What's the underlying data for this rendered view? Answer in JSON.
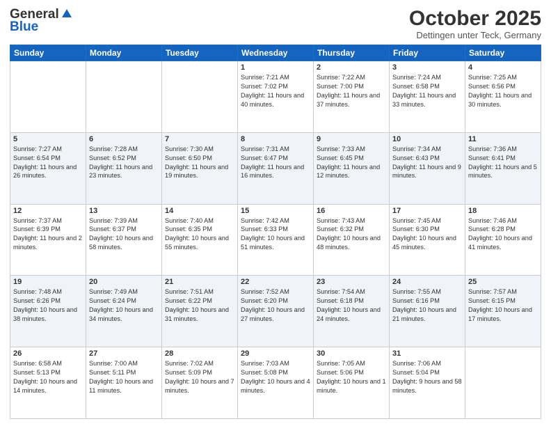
{
  "header": {
    "logo_line1": "General",
    "logo_line2": "Blue",
    "month": "October 2025",
    "location": "Dettingen unter Teck, Germany"
  },
  "weekdays": [
    "Sunday",
    "Monday",
    "Tuesday",
    "Wednesday",
    "Thursday",
    "Friday",
    "Saturday"
  ],
  "weeks": [
    [
      {
        "day": "",
        "info": ""
      },
      {
        "day": "",
        "info": ""
      },
      {
        "day": "",
        "info": ""
      },
      {
        "day": "1",
        "info": "Sunrise: 7:21 AM\nSunset: 7:02 PM\nDaylight: 11 hours and 40 minutes."
      },
      {
        "day": "2",
        "info": "Sunrise: 7:22 AM\nSunset: 7:00 PM\nDaylight: 11 hours and 37 minutes."
      },
      {
        "day": "3",
        "info": "Sunrise: 7:24 AM\nSunset: 6:58 PM\nDaylight: 11 hours and 33 minutes."
      },
      {
        "day": "4",
        "info": "Sunrise: 7:25 AM\nSunset: 6:56 PM\nDaylight: 11 hours and 30 minutes."
      }
    ],
    [
      {
        "day": "5",
        "info": "Sunrise: 7:27 AM\nSunset: 6:54 PM\nDaylight: 11 hours and 26 minutes."
      },
      {
        "day": "6",
        "info": "Sunrise: 7:28 AM\nSunset: 6:52 PM\nDaylight: 11 hours and 23 minutes."
      },
      {
        "day": "7",
        "info": "Sunrise: 7:30 AM\nSunset: 6:50 PM\nDaylight: 11 hours and 19 minutes."
      },
      {
        "day": "8",
        "info": "Sunrise: 7:31 AM\nSunset: 6:47 PM\nDaylight: 11 hours and 16 minutes."
      },
      {
        "day": "9",
        "info": "Sunrise: 7:33 AM\nSunset: 6:45 PM\nDaylight: 11 hours and 12 minutes."
      },
      {
        "day": "10",
        "info": "Sunrise: 7:34 AM\nSunset: 6:43 PM\nDaylight: 11 hours and 9 minutes."
      },
      {
        "day": "11",
        "info": "Sunrise: 7:36 AM\nSunset: 6:41 PM\nDaylight: 11 hours and 5 minutes."
      }
    ],
    [
      {
        "day": "12",
        "info": "Sunrise: 7:37 AM\nSunset: 6:39 PM\nDaylight: 11 hours and 2 minutes."
      },
      {
        "day": "13",
        "info": "Sunrise: 7:39 AM\nSunset: 6:37 PM\nDaylight: 10 hours and 58 minutes."
      },
      {
        "day": "14",
        "info": "Sunrise: 7:40 AM\nSunset: 6:35 PM\nDaylight: 10 hours and 55 minutes."
      },
      {
        "day": "15",
        "info": "Sunrise: 7:42 AM\nSunset: 6:33 PM\nDaylight: 10 hours and 51 minutes."
      },
      {
        "day": "16",
        "info": "Sunrise: 7:43 AM\nSunset: 6:32 PM\nDaylight: 10 hours and 48 minutes."
      },
      {
        "day": "17",
        "info": "Sunrise: 7:45 AM\nSunset: 6:30 PM\nDaylight: 10 hours and 45 minutes."
      },
      {
        "day": "18",
        "info": "Sunrise: 7:46 AM\nSunset: 6:28 PM\nDaylight: 10 hours and 41 minutes."
      }
    ],
    [
      {
        "day": "19",
        "info": "Sunrise: 7:48 AM\nSunset: 6:26 PM\nDaylight: 10 hours and 38 minutes."
      },
      {
        "day": "20",
        "info": "Sunrise: 7:49 AM\nSunset: 6:24 PM\nDaylight: 10 hours and 34 minutes."
      },
      {
        "day": "21",
        "info": "Sunrise: 7:51 AM\nSunset: 6:22 PM\nDaylight: 10 hours and 31 minutes."
      },
      {
        "day": "22",
        "info": "Sunrise: 7:52 AM\nSunset: 6:20 PM\nDaylight: 10 hours and 27 minutes."
      },
      {
        "day": "23",
        "info": "Sunrise: 7:54 AM\nSunset: 6:18 PM\nDaylight: 10 hours and 24 minutes."
      },
      {
        "day": "24",
        "info": "Sunrise: 7:55 AM\nSunset: 6:16 PM\nDaylight: 10 hours and 21 minutes."
      },
      {
        "day": "25",
        "info": "Sunrise: 7:57 AM\nSunset: 6:15 PM\nDaylight: 10 hours and 17 minutes."
      }
    ],
    [
      {
        "day": "26",
        "info": "Sunrise: 6:58 AM\nSunset: 5:13 PM\nDaylight: 10 hours and 14 minutes."
      },
      {
        "day": "27",
        "info": "Sunrise: 7:00 AM\nSunset: 5:11 PM\nDaylight: 10 hours and 11 minutes."
      },
      {
        "day": "28",
        "info": "Sunrise: 7:02 AM\nSunset: 5:09 PM\nDaylight: 10 hours and 7 minutes."
      },
      {
        "day": "29",
        "info": "Sunrise: 7:03 AM\nSunset: 5:08 PM\nDaylight: 10 hours and 4 minutes."
      },
      {
        "day": "30",
        "info": "Sunrise: 7:05 AM\nSunset: 5:06 PM\nDaylight: 10 hours and 1 minute."
      },
      {
        "day": "31",
        "info": "Sunrise: 7:06 AM\nSunset: 5:04 PM\nDaylight: 9 hours and 58 minutes."
      },
      {
        "day": "",
        "info": ""
      }
    ]
  ]
}
